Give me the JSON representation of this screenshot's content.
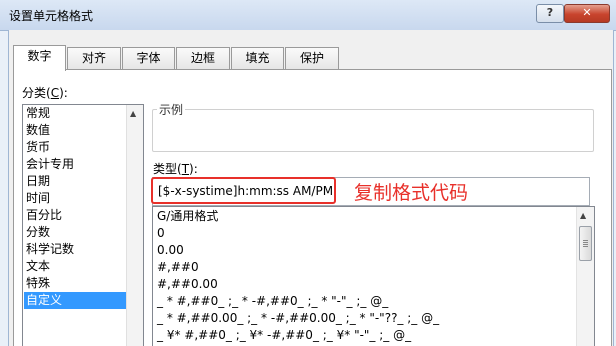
{
  "window": {
    "title": "设置单元格格式",
    "help_label": "?",
    "close_label": "✕"
  },
  "tabs": [
    {
      "label": "数字"
    },
    {
      "label": "对齐"
    },
    {
      "label": "字体"
    },
    {
      "label": "边框"
    },
    {
      "label": "填充"
    },
    {
      "label": "保护"
    }
  ],
  "category": {
    "label_text": "分类(",
    "label_key": "C",
    "label_end": "):",
    "items": [
      "常规",
      "数值",
      "货币",
      "会计专用",
      "日期",
      "时间",
      "百分比",
      "分数",
      "科学记数",
      "文本",
      "特殊",
      "自定义"
    ],
    "selected": "自定义"
  },
  "sample": {
    "label": "示例"
  },
  "type": {
    "label_text": "类型(",
    "label_key": "T",
    "label_end": "):",
    "value": "[$-x-systime]h:mm:ss AM/PM"
  },
  "annotation": {
    "text": "复制格式代码",
    "color": "#e8302a"
  },
  "formats": [
    "G/通用格式",
    "0",
    "0.00",
    "#,##0",
    "#,##0.00",
    "_ * #,##0_ ;_ * -#,##0_ ;_ * \"-\"_ ;_ @_",
    "_ * #,##0.00_ ;_ * -#,##0.00_ ;_ * \"-\"??_ ;_ @_",
    "_ ¥* #,##0_ ;_ ¥* -#,##0_ ;_ ¥* \"-\"_ ;_ @_"
  ]
}
